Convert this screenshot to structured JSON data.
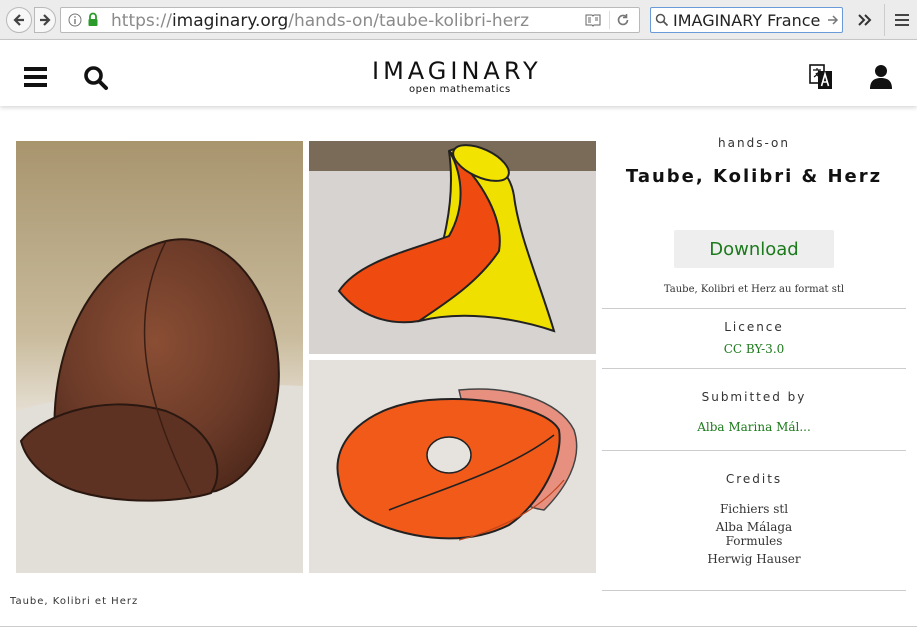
{
  "browser": {
    "url_scheme": "https://",
    "url_domain": "imaginary.org",
    "url_path": "/hands-on/taube-kolibri-herz",
    "search_text": "IMAGINARY France",
    "icons": {
      "back": "back-arrow-icon",
      "forward": "forward-arrow-icon",
      "info": "info-icon",
      "lock": "lock-icon",
      "reader": "reader-view-icon",
      "reload": "reload-icon",
      "search": "search-icon",
      "overflow": "double-chevron-icon",
      "menu": "hamburger-menu-icon"
    }
  },
  "site": {
    "logo_main": "IMAGINARY",
    "logo_sub": "open mathematics"
  },
  "gallery": {
    "caption": "Taube, Kolibri et Herz"
  },
  "sidebar": {
    "kicker": "hands-on",
    "title": "Taube, Kolibri & Herz",
    "download_label": "Download",
    "download_note": "Taube, Kolibri et Herz au format stl",
    "licence_heading": "Licence",
    "licence_value": "CC BY-3.0",
    "submitted_heading": "Submitted by",
    "submitted_value": "Alba Marina Mál...",
    "credits_heading": "Credits",
    "credits": [
      "Fichiers stl",
      "Alba Málaga",
      "Formules",
      "Herwig Hauser"
    ]
  },
  "colors": {
    "accent_green": "#1c7a1c",
    "dove_brown": "#6b3a28",
    "hummingbird_yellow": "#f0e000",
    "heart_orange": "#ef4a10"
  }
}
